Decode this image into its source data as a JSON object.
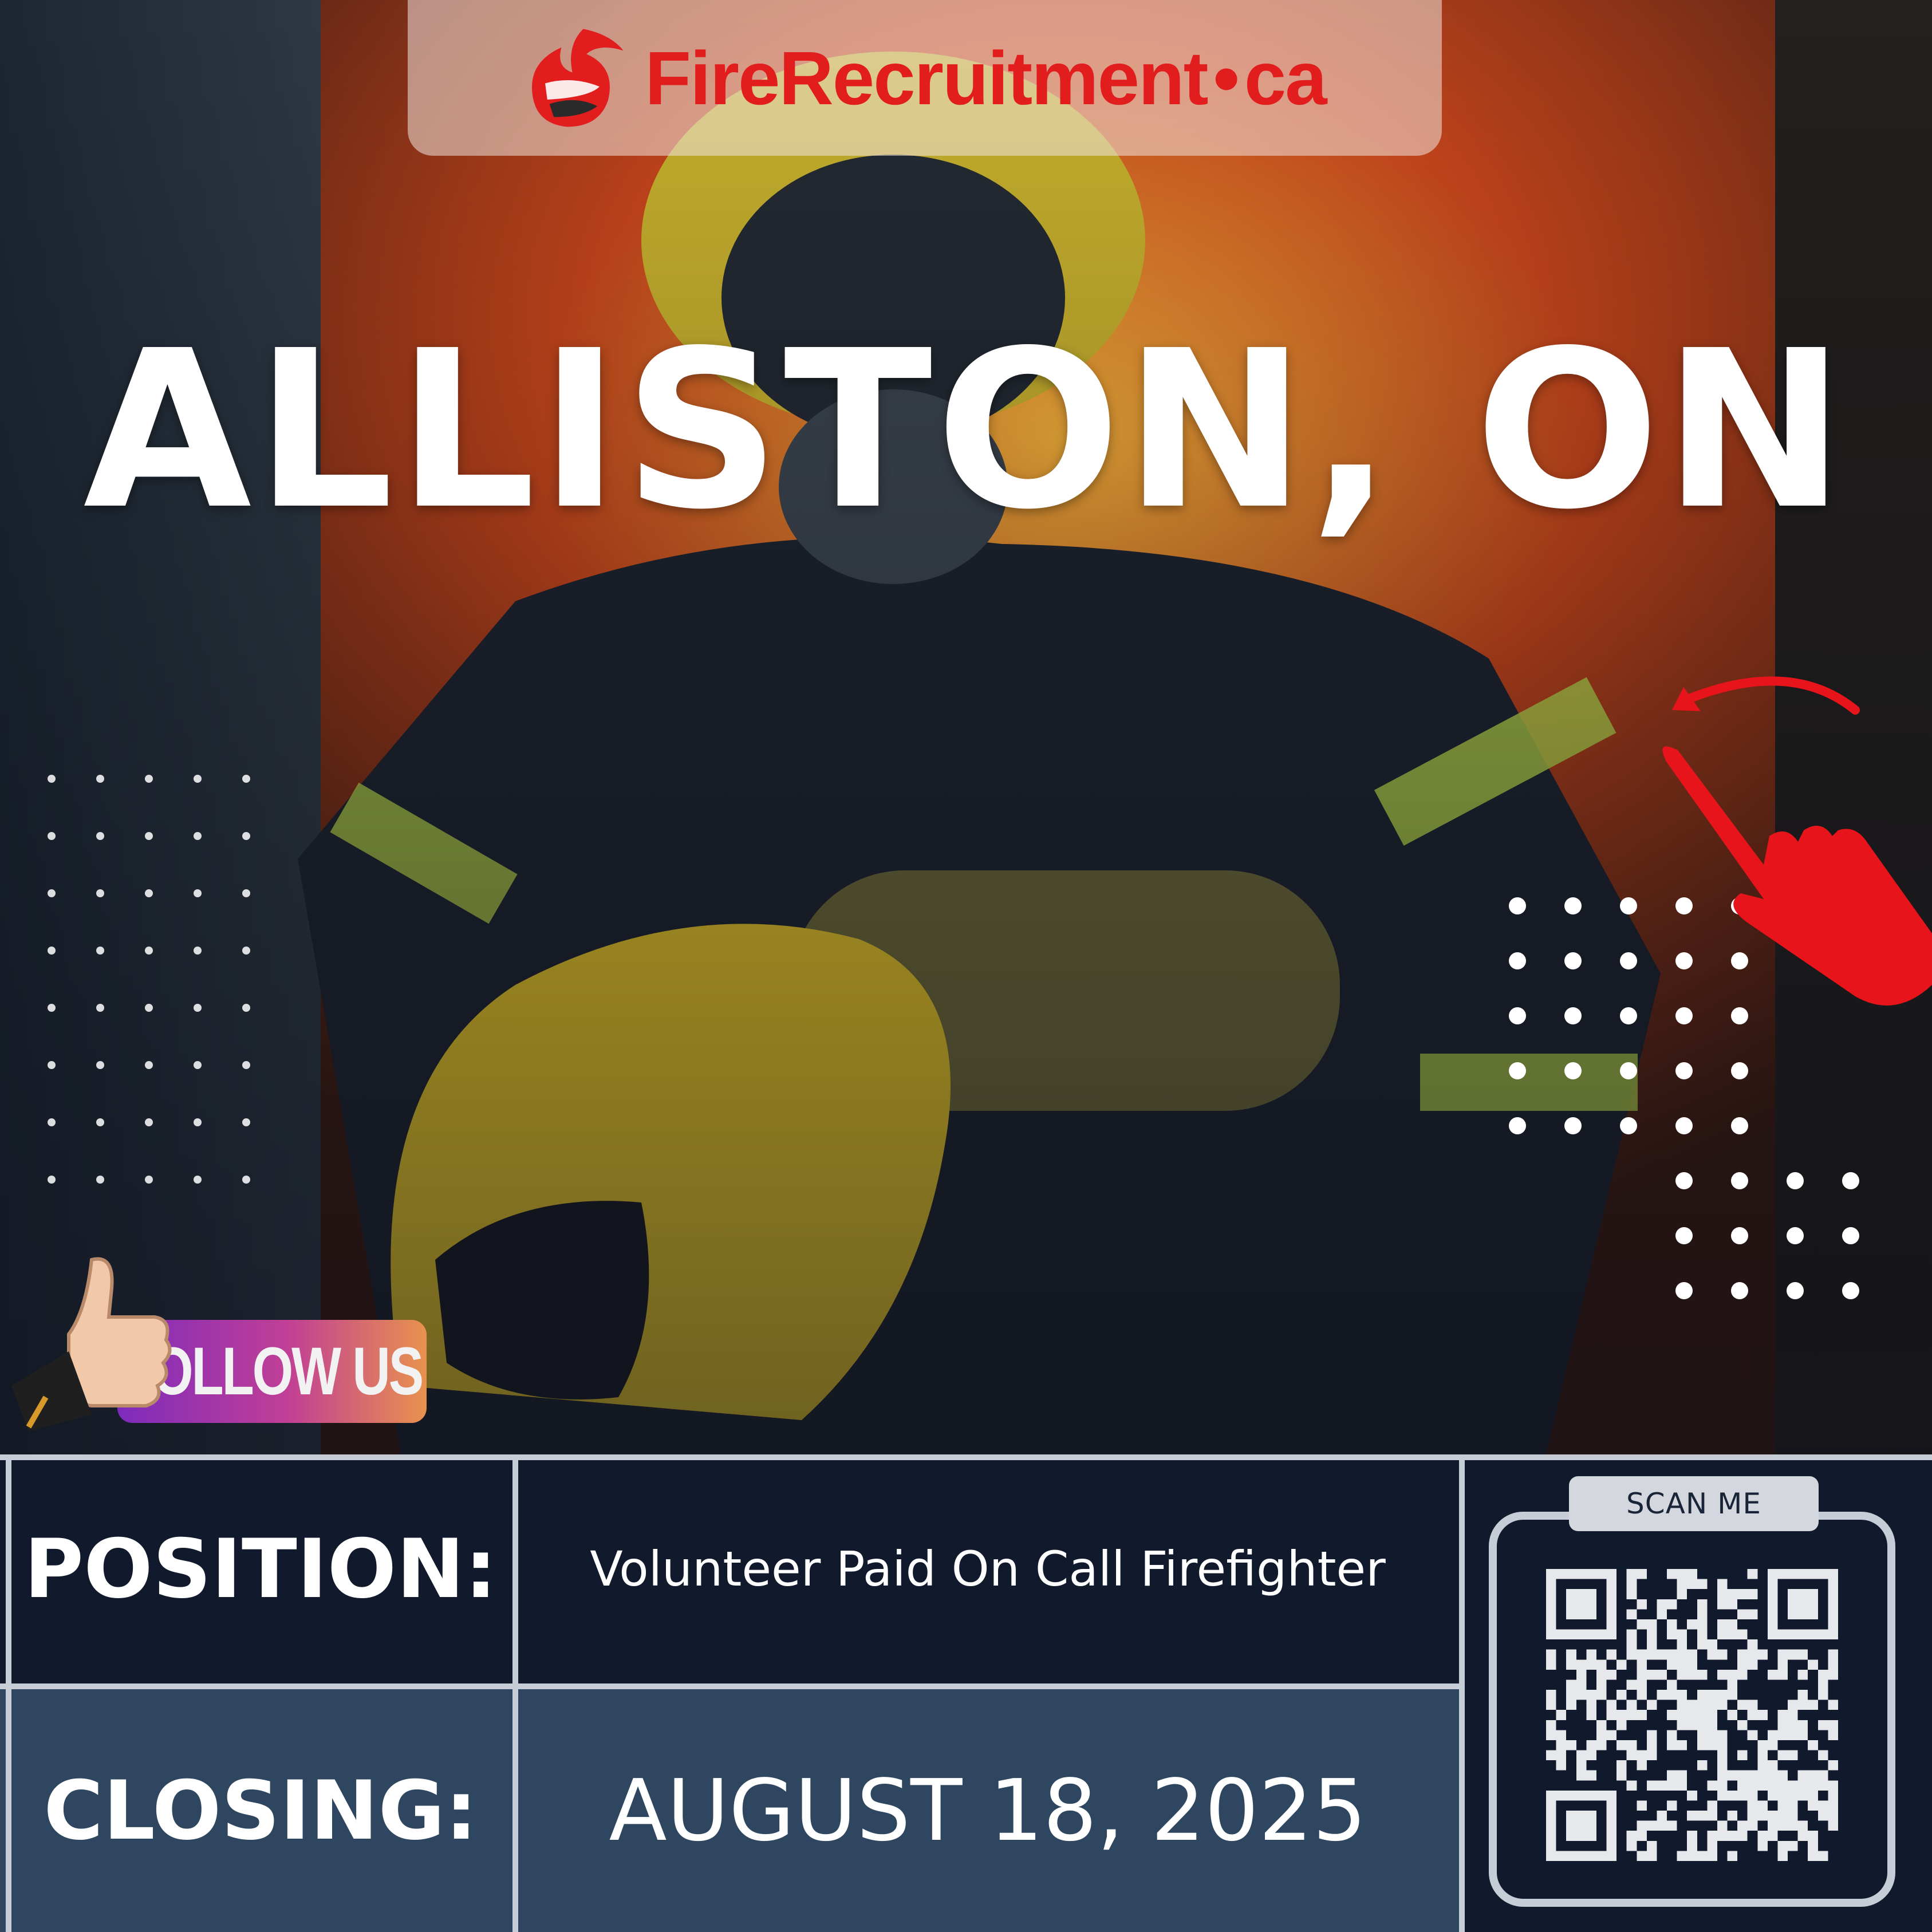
{
  "brand": {
    "name_primary": "FireRecruitment",
    "name_separator": "•",
    "name_suffix": "ca",
    "color": "#e21d1d"
  },
  "headline": {
    "city": "ALLISTON, ON"
  },
  "social": {
    "follow_label": "FOLLOW US",
    "thumb_icon": "thumbs-up-icon"
  },
  "pointer": {
    "icon": "pointing-hand-icon",
    "arrow_icon": "curved-arrow-icon",
    "color": "#e8141c"
  },
  "info": {
    "position_label": "POSITION:",
    "position_value": "Volunteer Paid On Call Firefighter",
    "closing_label": "CLOSING:",
    "closing_value": "AUGUST 18, 2025",
    "scan_label": "SCAN ME"
  },
  "colors": {
    "navy": "#101a2c",
    "slate": "#2f4660",
    "grid_line": "#c7cdd6"
  }
}
